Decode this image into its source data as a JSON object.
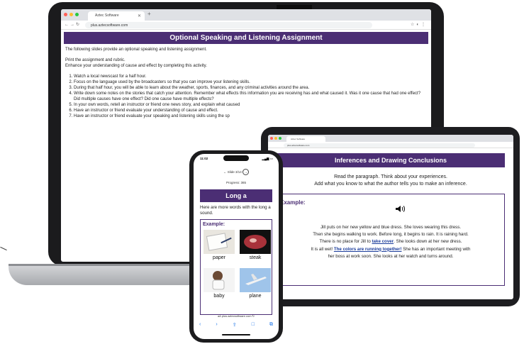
{
  "laptop": {
    "tab_title": "Aztec Software",
    "url": "plus.aztecsoftware.com",
    "page_title": "Optional Speaking and Listening Assignment",
    "intro": "The following slides provide an optional speaking and listening assignment.",
    "print_line": "Print the assignment and rubric.",
    "enhance_line": "Enhance your understanding of cause and effect by completing this activity.",
    "steps": [
      "Watch a local newscast for a half hour.",
      "Focus on the language used by the broadcasters so that you can improve your listening skills.",
      "During that half hour, you will be able to learn about the weather, sports, finances, and any criminal activities around the area.",
      "Write down some notes on the stories that catch your attention. Remember what effects this information you are receiving has and what caused it. Was it one cause that had one effect? Did multiple causes have one effect? Did one cause have multiple effects?",
      "In your own words, retell an instructor or friend one news story, and explain what caused",
      "Have an instructor or friend evaluate your understanding of cause and effect.",
      "Have an instructor or friend evaluate your speaking and listening skills using the sp"
    ]
  },
  "tablet": {
    "tab_title": "Aztec Software",
    "url": "plus.aztecsoftware.com",
    "page_title": "Inferences and Drawing Conclusions",
    "instruction_1": "Read the paragraph. Think about your experiences.",
    "instruction_2": "Add what you know to what the author tells you to make an inference.",
    "example_label": "Example:",
    "speaker_icon": "speaker-icon",
    "para_1": "Jill puts on her new yellow and blue dress. She loves wearing this dress.",
    "para_2": "Then she begins walking to work. Before long, it begins to rain. It is raining hard.",
    "para_3a": "There is no place for Jill to ",
    "link_1": "take cover",
    "para_3b": ". She looks down at her new dress.",
    "para_4a": "It is all wet! ",
    "link_2": "The colors are running together!",
    "para_4b": " She has an important meeting with",
    "para_5": "her boss at work soon. She looks at her watch and turns around."
  },
  "phone": {
    "time": "11:02",
    "slide_label": "Slide 3/14",
    "progress": "Progress: 365",
    "page_title": "Long a",
    "intro": "Here are more words with the long a sound.",
    "example_label": "Example:",
    "words": [
      "paper",
      "steak",
      "baby",
      "plane"
    ],
    "url": "plus.aztecsoftware.com",
    "aA": "aA"
  },
  "colors": {
    "accent": "#4b2e74",
    "link": "#1a3c9b"
  }
}
